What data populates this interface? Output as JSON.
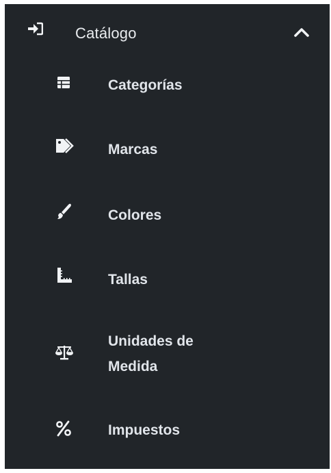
{
  "menu": {
    "header": {
      "label": "Catálogo",
      "icon": "sign-in-icon",
      "expanded": true
    },
    "items": [
      {
        "label": "Categorías",
        "icon": "list-icon"
      },
      {
        "label": "Marcas",
        "icon": "tags-icon"
      },
      {
        "label": "Colores",
        "icon": "paint-brush-icon"
      },
      {
        "label": "Tallas",
        "icon": "ruler-combined-icon"
      },
      {
        "label": "Unidades de\nMedida",
        "icon": "balance-scale-icon"
      },
      {
        "label": "Impuestos",
        "icon": "percent-icon"
      }
    ]
  },
  "colors": {
    "background": "#212529",
    "text": "#e9ecef"
  }
}
